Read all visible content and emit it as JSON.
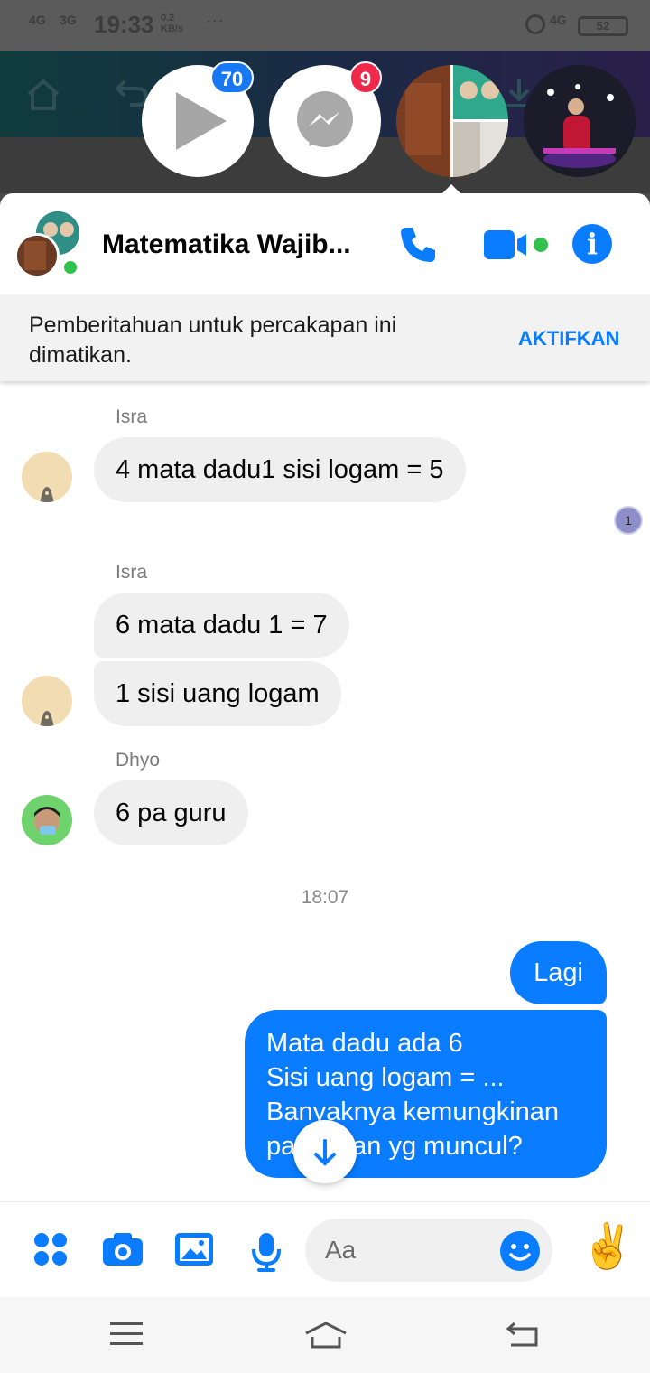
{
  "status_bar": {
    "network_1": "4G",
    "network_2": "3G",
    "time": "19:33",
    "speed_value": "0.2",
    "speed_unit": "KB/s",
    "more": "···",
    "network_right": "4G",
    "battery": "52"
  },
  "chat_heads": {
    "video_badge": "70",
    "messenger_badge": "9"
  },
  "chat": {
    "title": "Matematika Wajib...",
    "notice_text": "Pemberitahuan untuk percakapan ini dimatikan.",
    "notice_action": "AKTIFKAN",
    "seen_marker": "1"
  },
  "messages": [
    {
      "sender": "Isra",
      "text": "4 mata dadu1 sisi logam = 5"
    },
    {
      "sender": "Isra",
      "text": "6 mata dadu 1 = 7"
    },
    {
      "text": "1 sisi uang logam"
    },
    {
      "sender": "Dhyo",
      "text": "6 pa guru"
    }
  ],
  "timestamp": "18:07",
  "outgoing": [
    {
      "text": "Lagi"
    },
    {
      "lines": [
        "Mata dadu ada 6",
        "Sisi uang logam = ...",
        "Banyaknya kemungkinan",
        "pasangan yg muncul?"
      ]
    }
  ],
  "composer": {
    "placeholder": "Aa",
    "like_emoji": "✌️"
  },
  "colors": {
    "accent": "#0a7cff",
    "online": "#31c24d",
    "badge_red": "#f02849",
    "badge_blue": "#1877f2"
  }
}
